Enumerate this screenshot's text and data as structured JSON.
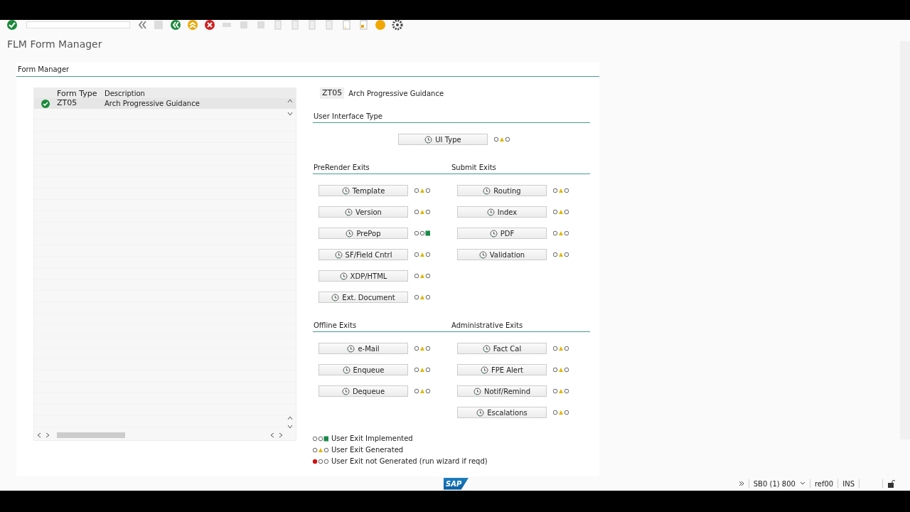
{
  "window": {
    "title": "FLM Form Manager"
  },
  "group_title": "Form Manager",
  "table": {
    "columns": [
      "Form Type",
      "Description"
    ],
    "rows": [
      {
        "cells": [
          "ZT05",
          "Arch Progressive Guidance"
        ],
        "selected": true
      }
    ]
  },
  "header": {
    "code": "ZT05",
    "description": "Arch Progressive Guidance"
  },
  "sections": [
    {
      "kind": "single",
      "title": "User Interface Type",
      "items": [
        {
          "label": "UI Type",
          "kind": "generated"
        }
      ]
    },
    {
      "kind": "pair",
      "groups": [
        {
          "title": "PreRender Exits",
          "items": [
            {
              "label": "Template",
              "kind": "generated"
            },
            {
              "label": "Version",
              "kind": "generated"
            },
            {
              "label": "PrePop",
              "kind": "implemented"
            },
            {
              "label": "SF/Field Cntrl",
              "kind": "generated"
            },
            {
              "label": "XDP/HTML",
              "kind": "generated"
            },
            {
              "label": "Ext. Document",
              "kind": "generated"
            }
          ]
        },
        {
          "title": "Submit Exits",
          "items": [
            {
              "label": "Routing",
              "kind": "generated"
            },
            {
              "label": "Index",
              "kind": "generated"
            },
            {
              "label": "PDF",
              "kind": "generated"
            },
            {
              "label": "Validation",
              "kind": "generated"
            }
          ]
        }
      ]
    },
    {
      "kind": "pair",
      "groups": [
        {
          "title": "Offline Exits",
          "items": [
            {
              "label": "e-Mail",
              "kind": "generated"
            },
            {
              "label": "Enqueue",
              "kind": "generated"
            },
            {
              "label": "Dequeue",
              "kind": "generated"
            }
          ]
        },
        {
          "title": "Administrative Exits",
          "items": [
            {
              "label": "Fact Cal",
              "kind": "generated"
            },
            {
              "label": "FPE Alert",
              "kind": "generated"
            },
            {
              "label": "Notif/Remind",
              "kind": "generated"
            },
            {
              "label": "Escalations",
              "kind": "generated"
            }
          ]
        }
      ]
    }
  ],
  "legend": [
    {
      "kind": "implemented",
      "label": "User Exit Implemented"
    },
    {
      "kind": "generated",
      "label": "User Exit Generated"
    },
    {
      "kind": "not_generated",
      "label": "User Exit not Generated (run wizard if reqd)"
    }
  ],
  "status_bar": {
    "logo": "SAP",
    "items": [
      "SB0 (1) 800",
      "ref00",
      "INS"
    ]
  }
}
